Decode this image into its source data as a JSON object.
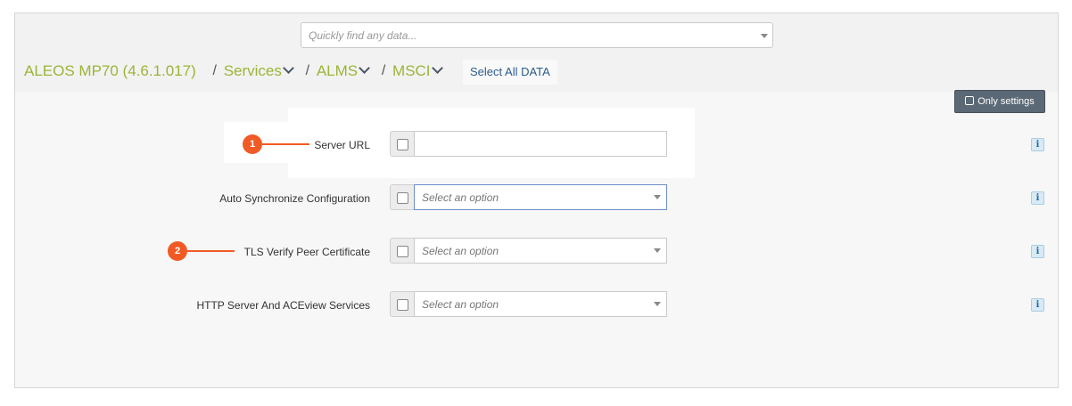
{
  "search": {
    "placeholder": "Quickly find any data..."
  },
  "breadcrumb": {
    "device": "ALEOS MP70 (4.6.1.017)",
    "items": [
      "Services",
      "ALMS",
      "MSCI"
    ],
    "separator": "/"
  },
  "toolbar": {
    "select_all_label": "Select All DATA",
    "only_settings_label": "Only settings"
  },
  "fields": [
    {
      "label": "Server URL",
      "type": "text",
      "value": "",
      "marker": "1"
    },
    {
      "label": "Auto Synchronize Configuration",
      "type": "select",
      "placeholder": "Select an option"
    },
    {
      "label": "TLS Verify Peer Certificate",
      "type": "select",
      "placeholder": "Select an option",
      "marker": "2"
    },
    {
      "label": "HTTP Server And ACEview Services",
      "type": "select",
      "placeholder": "Select an option"
    }
  ],
  "info_icon": "i",
  "colors": {
    "accent": "#9bb537",
    "marker": "#f15a24",
    "button": "#5b6875",
    "link": "#2b5c8a"
  }
}
